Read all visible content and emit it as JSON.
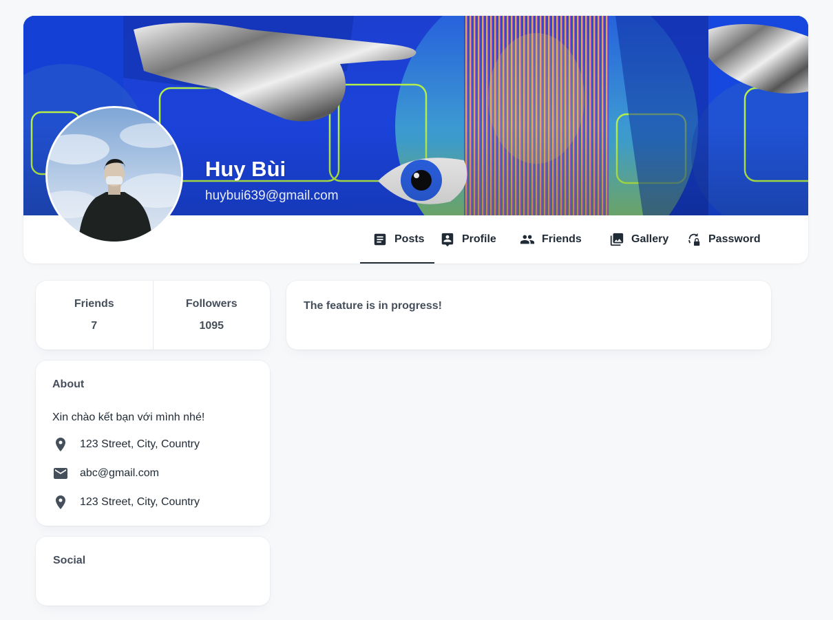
{
  "profile": {
    "name": "Huy Bùi",
    "email": "huybui639@gmail.com"
  },
  "tabs": [
    {
      "label": "Posts",
      "icon": "article-icon",
      "active": true
    },
    {
      "label": "Profile",
      "icon": "contact-icon",
      "active": false
    },
    {
      "label": "Friends",
      "icon": "people-icon",
      "active": false
    },
    {
      "label": "Gallery",
      "icon": "photo-library-icon",
      "active": false
    },
    {
      "label": "Password",
      "icon": "password-reset-icon",
      "active": false
    }
  ],
  "stats": [
    {
      "label": "Friends",
      "value": "7"
    },
    {
      "label": "Followers",
      "value": "1095"
    }
  ],
  "about": {
    "title": "About",
    "intro": "Xin chào kết bạn với mình nhé!",
    "items": [
      {
        "icon": "location-icon",
        "text": "123 Street, City, Country"
      },
      {
        "icon": "mail-icon",
        "text": "abc@gmail.com"
      },
      {
        "icon": "location-icon",
        "text": "123 Street, City, Country"
      }
    ]
  },
  "social": {
    "title": "Social"
  },
  "feed": {
    "message": "The feature is in progress!"
  },
  "colors": {
    "cover_blue": "#1f47d6",
    "text_primary": "#212b36",
    "text_secondary": "#454f5b",
    "page_background": "#f7f8fa"
  }
}
